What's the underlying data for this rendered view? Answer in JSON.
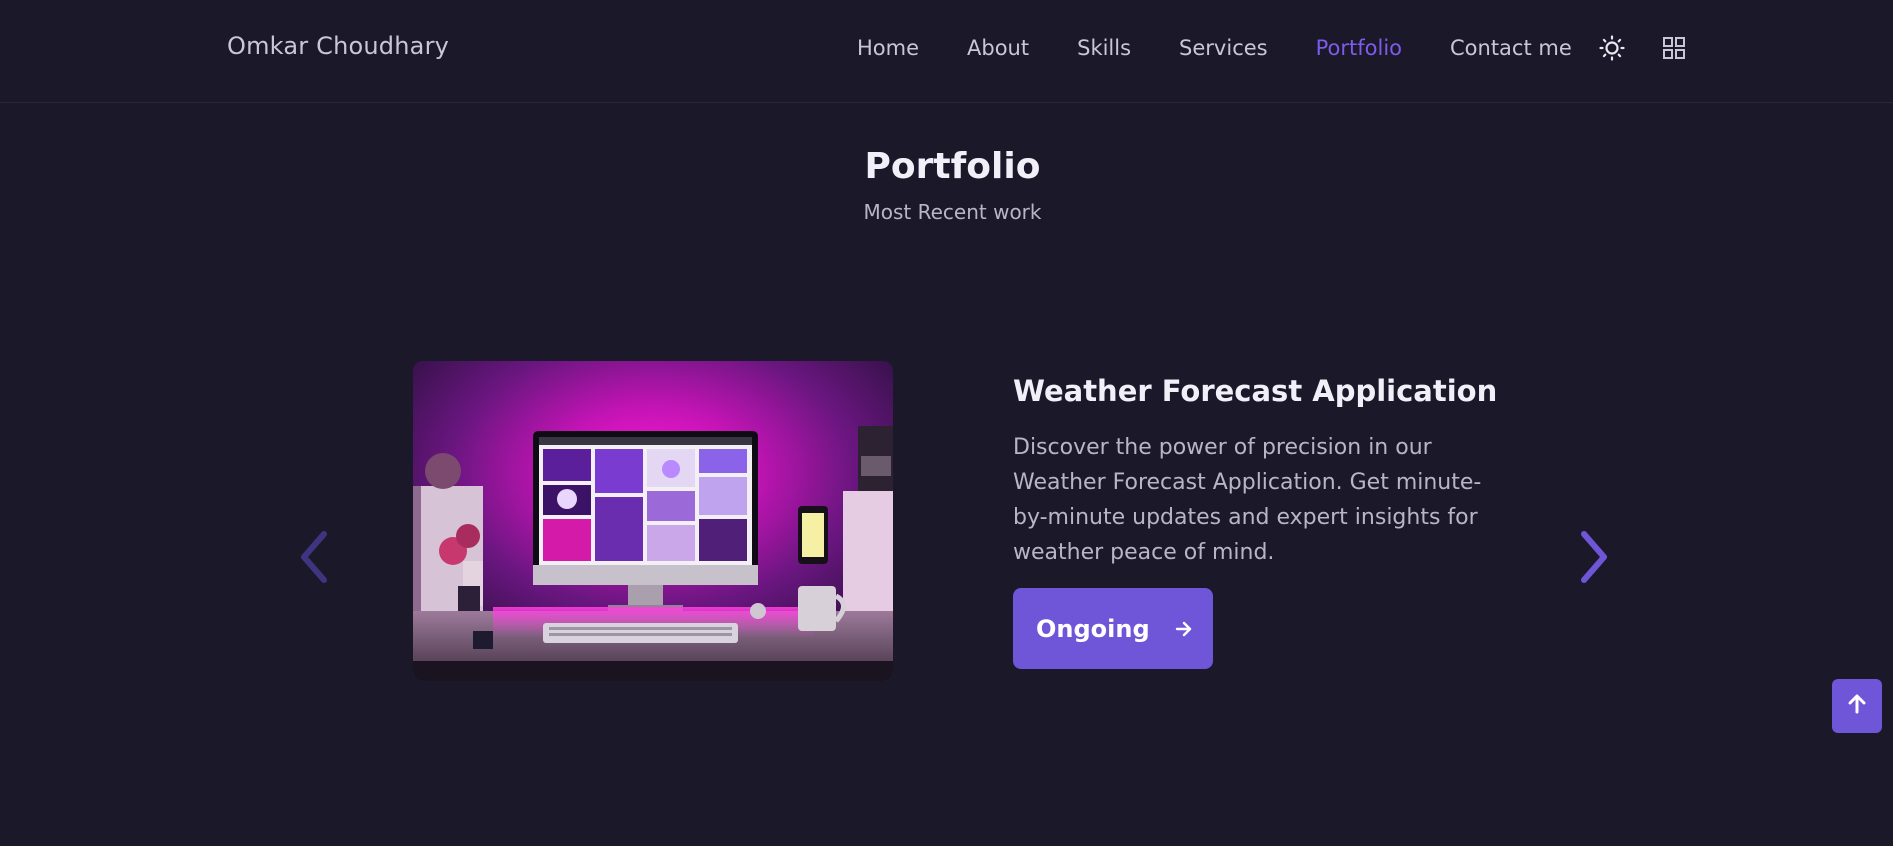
{
  "header": {
    "brand": "Omkar Choudhary",
    "nav": [
      {
        "label": "Home",
        "active": false
      },
      {
        "label": "About",
        "active": false
      },
      {
        "label": "Skills",
        "active": false
      },
      {
        "label": "Services",
        "active": false
      },
      {
        "label": "Portfolio",
        "active": true
      },
      {
        "label": "Contact me",
        "active": false
      }
    ],
    "theme_icon": "sun-icon",
    "menu_icon": "grid-icon"
  },
  "section": {
    "title": "Portfolio",
    "subtitle": "Most Recent work"
  },
  "project": {
    "image_subject": "desk-setup-photo",
    "title": "Weather Forecast Application",
    "description": "Discover the power of precision in our Weather Forecast Application. Get minute-by-minute updates and expert insights for weather peace of mind.",
    "button_label": "Ongoing",
    "button_icon": "arrow-right-icon"
  },
  "carousel": {
    "prev_icon": "chevron-left-icon",
    "next_icon": "chevron-right-icon"
  },
  "scroll_top_icon": "arrow-up-icon",
  "colors": {
    "background": "#1b1829",
    "accent": "#6f55d8",
    "active_nav": "#7c5ce9",
    "text_primary": "#f1eff8",
    "text_secondary": "#b9b5c9"
  }
}
